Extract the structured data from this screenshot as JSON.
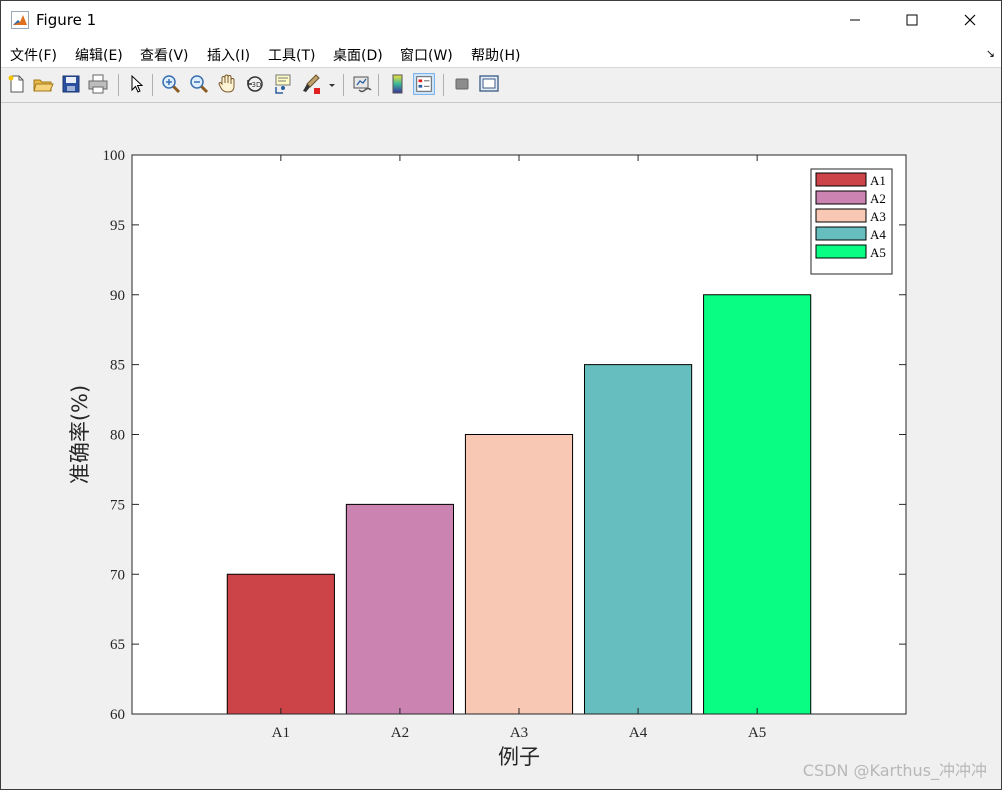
{
  "window": {
    "title": "Figure 1"
  },
  "menu": [
    {
      "label": "文件(F)",
      "name": "menu-file"
    },
    {
      "label": "编辑(E)",
      "name": "menu-edit"
    },
    {
      "label": "查看(V)",
      "name": "menu-view"
    },
    {
      "label": "插入(I)",
      "name": "menu-insert"
    },
    {
      "label": "工具(T)",
      "name": "menu-tools"
    },
    {
      "label": "桌面(D)",
      "name": "menu-desktop"
    },
    {
      "label": "窗口(W)",
      "name": "menu-window"
    },
    {
      "label": "帮助(H)",
      "name": "menu-help"
    }
  ],
  "toolbar": [
    "new-figure-icon",
    "open-file-icon",
    "save-icon",
    "print-icon",
    "select-arrow-icon",
    "zoom-in-icon",
    "zoom-out-icon",
    "pan-hand-icon",
    "rotate-3d-icon",
    "data-cursor-icon",
    "brush-icon",
    "link-plot-icon",
    "colorbar-icon",
    "legend-icon",
    "hide-plot-tools-icon",
    "show-plot-tools-icon"
  ],
  "colors": {
    "A1": "#cc4448",
    "A2": "#cb84b1",
    "A3": "#f9c8b5",
    "A4": "#66bfbe",
    "A5": "#08fd82"
  },
  "chart_data": {
    "type": "bar",
    "categories": [
      "A1",
      "A2",
      "A3",
      "A4",
      "A5"
    ],
    "values": [
      70,
      75,
      80,
      85,
      90
    ],
    "series_names": [
      "A1",
      "A2",
      "A3",
      "A4",
      "A5"
    ],
    "xlabel": "例子",
    "ylabel": "准确率(%)",
    "ylim": [
      60,
      100
    ],
    "yticks": [
      60,
      65,
      70,
      75,
      80,
      85,
      90,
      95,
      100
    ],
    "legend": "top-right",
    "grid": false
  },
  "watermark": "CSDN @Karthus_冲冲冲"
}
